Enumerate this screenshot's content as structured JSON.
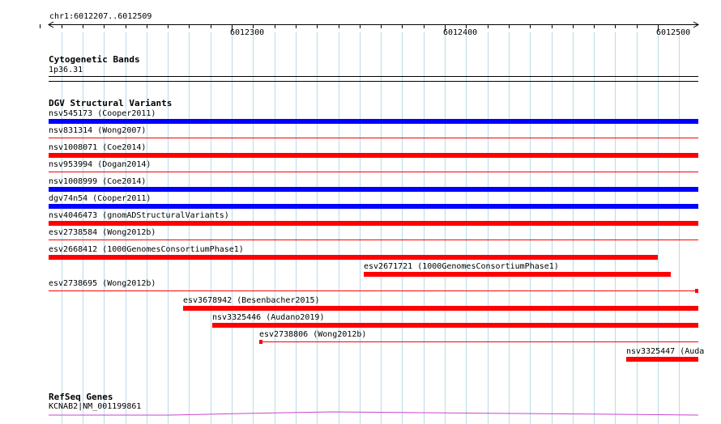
{
  "location": "chr1:6012207..6012509",
  "ruler": {
    "ticks": [
      {
        "label": "6012300",
        "pos": 6012300
      },
      {
        "label": "6012400",
        "pos": 6012400
      },
      {
        "label": "6012500",
        "pos": 6012500
      }
    ]
  },
  "colors": {
    "deletion": "#ff0000",
    "duplication": "#0000ff",
    "gene": "#cc44cc",
    "grid": "#b7dde8"
  },
  "tracks": {
    "cytoband": {
      "title": "Cytogenetic Bands",
      "band": "1p36.31"
    },
    "dgv": {
      "title": "DGV Structural Variants",
      "features": [
        {
          "label": "nsv545173 (Cooper2011)",
          "kind": "duplication",
          "start": 6012207,
          "end": 6012509,
          "extends_past_view": true
        },
        {
          "label": "nsv831314 (Wong2007)",
          "kind": "deletion",
          "start": 6012207,
          "end": 6012509,
          "extends_past_view": true
        },
        {
          "label": "nsv1008071 (Coe2014)",
          "kind": "deletion",
          "start": 6012207,
          "end": 6012509,
          "extends_past_view": true
        },
        {
          "label": "nsv953994 (Dogan2014)",
          "kind": "deletion",
          "start": 6012207,
          "end": 6012509,
          "extends_past_view": true
        },
        {
          "label": "nsv1008999 (Coe2014)",
          "kind": "duplication",
          "start": 6012207,
          "end": 6012509,
          "extends_past_view": true
        },
        {
          "label": "dgv74n54 (Cooper2011)",
          "kind": "duplication",
          "start": 6012207,
          "end": 6012509,
          "extends_past_view": true
        },
        {
          "label": "nsv4046473 (gnomADStructuralVariants)",
          "kind": "deletion",
          "start": 6012207,
          "end": 6012509,
          "extends_past_view": true
        },
        {
          "label": "esv2738584 (Wong2012b)",
          "kind": "deletion",
          "start": 6012207,
          "end": 6012509,
          "extends_past_view": true
        },
        {
          "label": "esv2668412 (1000GenomesConsortiumPhase1)",
          "kind": "deletion",
          "start": 6012207,
          "end": 6012500
        },
        {
          "label": "esv2671721 (1000GenomesConsortiumPhase1)",
          "kind": "deletion",
          "start": 6012362,
          "end": 6012506
        },
        {
          "label": "esv2738695 (Wong2012b)",
          "kind": "deletion",
          "start": 6012207,
          "end": 6012509,
          "extends_past_view": true
        },
        {
          "label": "esv3678942 (Besenbacher2015)",
          "kind": "deletion",
          "start": 6012277,
          "end": 6012509,
          "extends_past_view": true
        },
        {
          "label": "nsv3325446 (Audano2019)",
          "kind": "deletion",
          "start": 6012291,
          "end": 6012509,
          "extends_past_view": true
        },
        {
          "label": "esv2738806 (Wong2012b)",
          "kind": "deletion",
          "start": 6012313,
          "end": 6012509,
          "extends_past_view": true
        },
        {
          "label": "nsv3325447 (Auda",
          "kind": "deletion",
          "start": 6012485,
          "end": 6012509,
          "extends_past_view": true
        }
      ]
    },
    "genes": {
      "title": "RefSeq Genes",
      "features": [
        {
          "label": "KCNAB2|NM_001199861"
        }
      ]
    }
  }
}
